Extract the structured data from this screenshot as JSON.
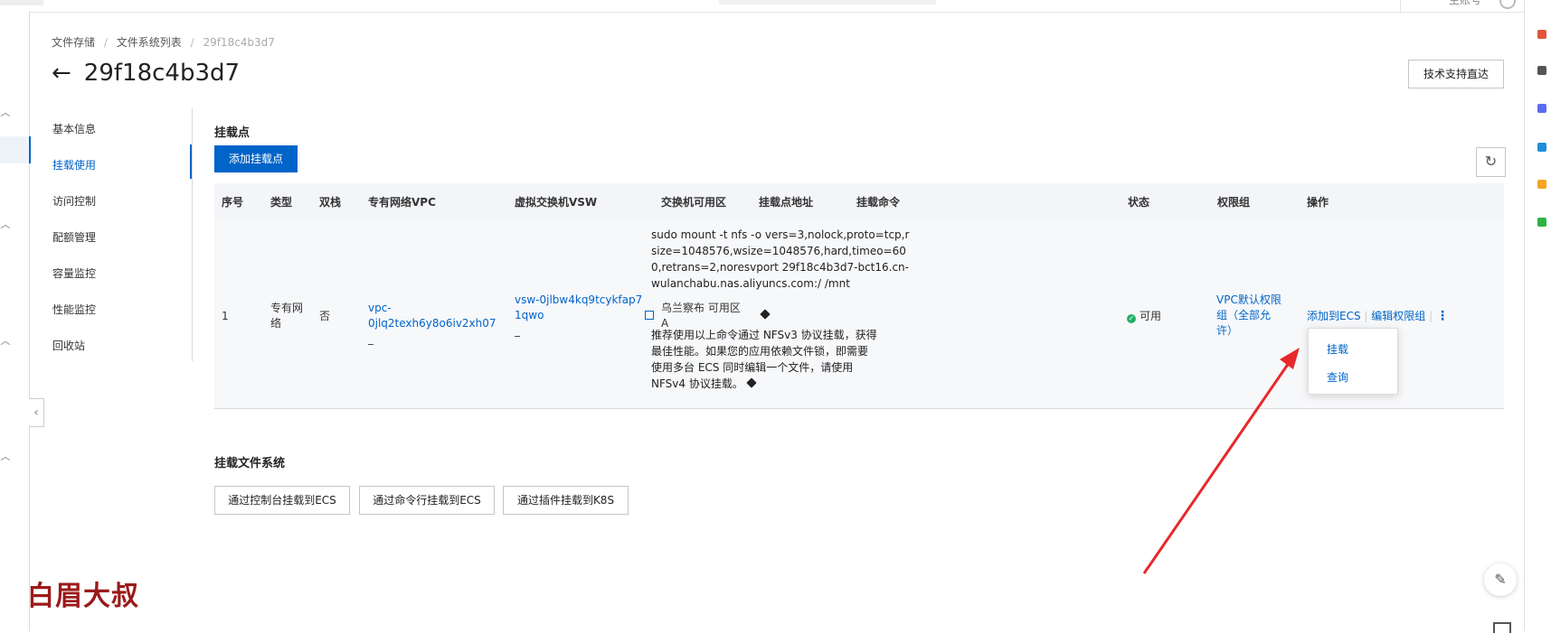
{
  "topbar": {
    "user": "主账号"
  },
  "breadcrumb": [
    "文件存储",
    "文件系统列表",
    "29f18c4b3d7"
  ],
  "page_title": "29f18c4b3d7",
  "support_button": "技术支持直达",
  "subnav": [
    "基本信息",
    "挂载使用",
    "访问控制",
    "配额管理",
    "容量监控",
    "性能监控",
    "回收站"
  ],
  "mount_section": {
    "title": "挂载点",
    "add_button": "添加挂载点",
    "columns": [
      "序号",
      "类型",
      "双栈",
      "专有网络VPC",
      "虚拟交换机VSW",
      "交换机可用区",
      "挂载点地址",
      "挂载命令",
      "状态",
      "权限组",
      "操作"
    ],
    "row": {
      "index": "1",
      "type": "专有网络",
      "dual_stack": "否",
      "vpc": "vpc-0jlq2texh6y8o6iv2xh07",
      "vpc_suffix": "_",
      "vsw": "vsw-0jlbw4kq9tcykfap71qwo",
      "vsw_suffix": "_",
      "zone": "乌兰察布 可用区A",
      "command": "sudo mount -t nfs -o vers=3,nolock,proto=tcp,rsize=1048576,wsize=1048576,hard,timeo=600,retrans=2,noresvport 29f18c4b3d7-bct16.cn-wulanchabu.nas.aliyuncs.com:/ /mnt",
      "tip": "推荐使用以上命令通过 NFSv3 协议挂载，获得最佳性能。如果您的应用依赖文件锁，即需要使用多台 ECS 同时编辑一个文件，请使用 NFSv4 协议挂载。",
      "status": "可用",
      "permission_group": "VPC默认权限组（全部允许）",
      "actions": [
        "添加到ECS",
        "编辑权限组"
      ]
    },
    "dropdown": [
      "挂载",
      "查询"
    ]
  },
  "fs_section": {
    "title": "挂载文件系统",
    "buttons": [
      "通过控制台挂载到ECS",
      "通过命令行挂载到ECS",
      "通过插件挂载到K8S"
    ]
  },
  "watermark": "白眉大叔",
  "colors": {
    "primary": "#0064c8",
    "success": "#23b066",
    "arrow": "#e8282b",
    "watermark": "#9b1a1a"
  }
}
